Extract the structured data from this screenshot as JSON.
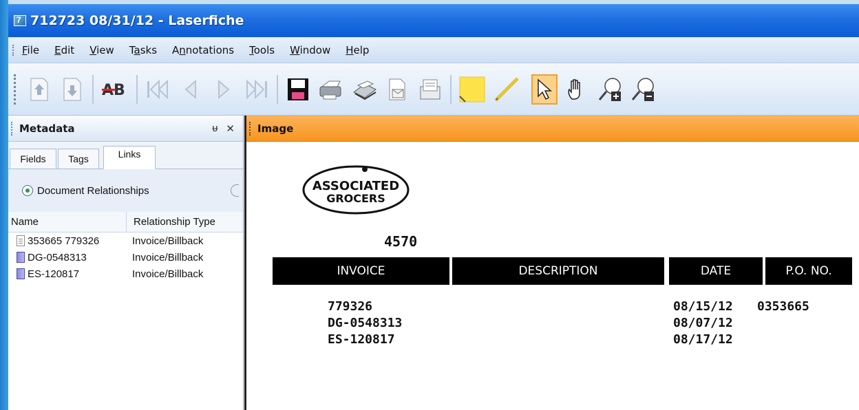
{
  "window": {
    "title": "712723 08/31/12 - Laserfiche"
  },
  "menu": [
    {
      "label": "File",
      "key": "F"
    },
    {
      "label": "Edit",
      "key": "E"
    },
    {
      "label": "View",
      "key": "V"
    },
    {
      "label": "Tasks",
      "key": "a"
    },
    {
      "label": "Annotations",
      "key": "n"
    },
    {
      "label": "Tools",
      "key": "T"
    },
    {
      "label": "Window",
      "key": "W"
    },
    {
      "label": "Help",
      "key": "H"
    }
  ],
  "toolbar": {
    "tools": [
      "up-arrow-icon",
      "down-arrow-icon",
      "strikeout-text-icon",
      "first-page-icon",
      "previous-page-icon",
      "next-page-icon",
      "last-page-icon",
      "save-icon",
      "print-icon",
      "scan-icon",
      "email-document-icon",
      "email-icon",
      "sticky-note-icon",
      "highlighter-icon",
      "pointer-select-icon",
      "hand-pan-icon",
      "zoom-in-icon",
      "zoom-out-icon"
    ],
    "active_tool": "pointer-select-icon"
  },
  "metadata_panel": {
    "title": "Metadata",
    "pin_label": "ᵾ",
    "close_label": "✕",
    "tabs": [
      {
        "label": "Fields",
        "selected": false
      },
      {
        "label": "Tags",
        "selected": false
      },
      {
        "label": "Links",
        "selected": true
      }
    ],
    "relationship_option": "Document Relationships",
    "columns": {
      "name": "Name",
      "type": "Relationship Type"
    },
    "rows": [
      {
        "name": "353665 779326",
        "type": "Invoice/Billback",
        "icon": "document-icon"
      },
      {
        "name": "DG-0548313",
        "type": "Invoice/Billback",
        "icon": "electronic-document-icon"
      },
      {
        "name": "ES-120817",
        "type": "Invoice/Billback",
        "icon": "electronic-document-icon"
      }
    ]
  },
  "image_panel": {
    "title": "Image",
    "document": {
      "logo_line1": "ASSOCIATED",
      "logo_line2": "GROCERS",
      "store_number": "4570",
      "headers": {
        "invoice": "INVOICE",
        "description": "DESCRIPTION",
        "date": "DATE",
        "po": "P.O. NO."
      },
      "invoices": [
        "779326",
        "DG-0548313",
        "ES-120817"
      ],
      "dates": [
        "08/15/12",
        "08/07/12",
        "08/17/12"
      ],
      "po_numbers": [
        "0353665"
      ]
    }
  },
  "colors": {
    "titlebar": "#1f6fe0",
    "image_header": "#f7951f",
    "active_tool": "#fcd28a"
  }
}
